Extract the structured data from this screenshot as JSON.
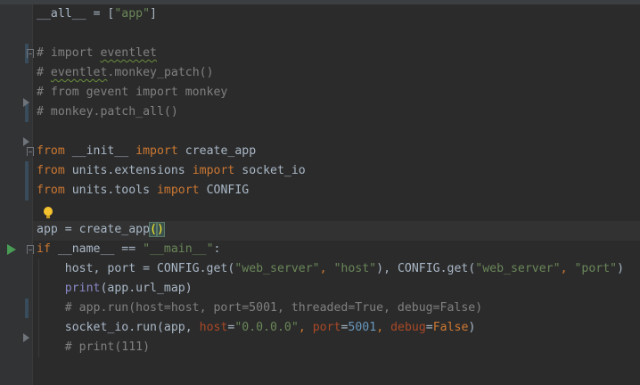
{
  "editor": {
    "lines": [
      [
        {
          "t": "__all__",
          "c": ""
        },
        {
          "t": " = [",
          "c": ""
        },
        {
          "t": "\"app\"",
          "c": "str"
        },
        {
          "t": "]",
          "c": ""
        }
      ],
      [],
      [
        {
          "t": "# import ",
          "c": "cmt"
        },
        {
          "t": "eventlet",
          "c": "cmt wavy"
        }
      ],
      [
        {
          "t": "# ",
          "c": "cmt"
        },
        {
          "t": "eventlet",
          "c": "cmt wavy"
        },
        {
          "t": ".monkey_patch()",
          "c": "cmt"
        }
      ],
      [
        {
          "t": "# from gevent import monkey",
          "c": "cmt"
        }
      ],
      [
        {
          "t": "# monkey.patch_all()",
          "c": "cmt"
        }
      ],
      [],
      [
        {
          "t": "from",
          "c": "kw"
        },
        {
          "t": " __init__ ",
          "c": ""
        },
        {
          "t": "import",
          "c": "kw"
        },
        {
          "t": " create_app",
          "c": ""
        }
      ],
      [
        {
          "t": "from",
          "c": "kw"
        },
        {
          "t": " units.extensions ",
          "c": ""
        },
        {
          "t": "import",
          "c": "kw"
        },
        {
          "t": " socket_io",
          "c": ""
        }
      ],
      [
        {
          "t": "from",
          "c": "kw"
        },
        {
          "t": " units.tools ",
          "c": ""
        },
        {
          "t": "import",
          "c": "kw"
        },
        {
          "t": " CONFIG",
          "c": ""
        }
      ],
      [],
      [
        {
          "t": "app = create_app",
          "c": ""
        },
        {
          "t": "(",
          "c": "paren-match"
        },
        {
          "t": ")",
          "c": "paren-match"
        }
      ],
      [
        {
          "t": "if",
          "c": "kw"
        },
        {
          "t": " __name__ == ",
          "c": ""
        },
        {
          "t": "\"__main__\"",
          "c": "str"
        },
        {
          "t": ":",
          "c": ""
        }
      ],
      [
        {
          "t": "    host, port = CONFIG.get(",
          "c": ""
        },
        {
          "t": "\"web_server\"",
          "c": "str"
        },
        {
          "t": ", ",
          "c": "kw"
        },
        {
          "t": "\"host\"",
          "c": "str"
        },
        {
          "t": "), CONFIG.get(",
          "c": ""
        },
        {
          "t": "\"web_server\"",
          "c": "str"
        },
        {
          "t": ", ",
          "c": "kw"
        },
        {
          "t": "\"port\"",
          "c": "str"
        },
        {
          "t": ")",
          "c": ""
        }
      ],
      [
        {
          "t": "    ",
          "c": ""
        },
        {
          "t": "print",
          "c": "builtin"
        },
        {
          "t": "(app.url_map)",
          "c": ""
        }
      ],
      [
        {
          "t": "    # app.run(host=host, port=5001, threaded=True, debug=False)",
          "c": "cmt"
        }
      ],
      [
        {
          "t": "    socket_io.run(app, ",
          "c": ""
        },
        {
          "t": "host",
          "c": "param"
        },
        {
          "t": "=",
          "c": ""
        },
        {
          "t": "\"0.0.0.0\"",
          "c": "str"
        },
        {
          "t": ", ",
          "c": "kw"
        },
        {
          "t": "port",
          "c": "param"
        },
        {
          "t": "=",
          "c": ""
        },
        {
          "t": "5001",
          "c": "num"
        },
        {
          "t": ", ",
          "c": "kw"
        },
        {
          "t": "debug",
          "c": "param"
        },
        {
          "t": "=",
          "c": ""
        },
        {
          "t": "False",
          "c": "kw"
        },
        {
          "t": ")",
          "c": ""
        }
      ],
      [
        {
          "t": "    # print(111)",
          "c": "cmt"
        }
      ]
    ]
  },
  "gutter": {
    "icons": [
      "fold-icon",
      "run-icon",
      "intention-bulb-icon"
    ]
  }
}
